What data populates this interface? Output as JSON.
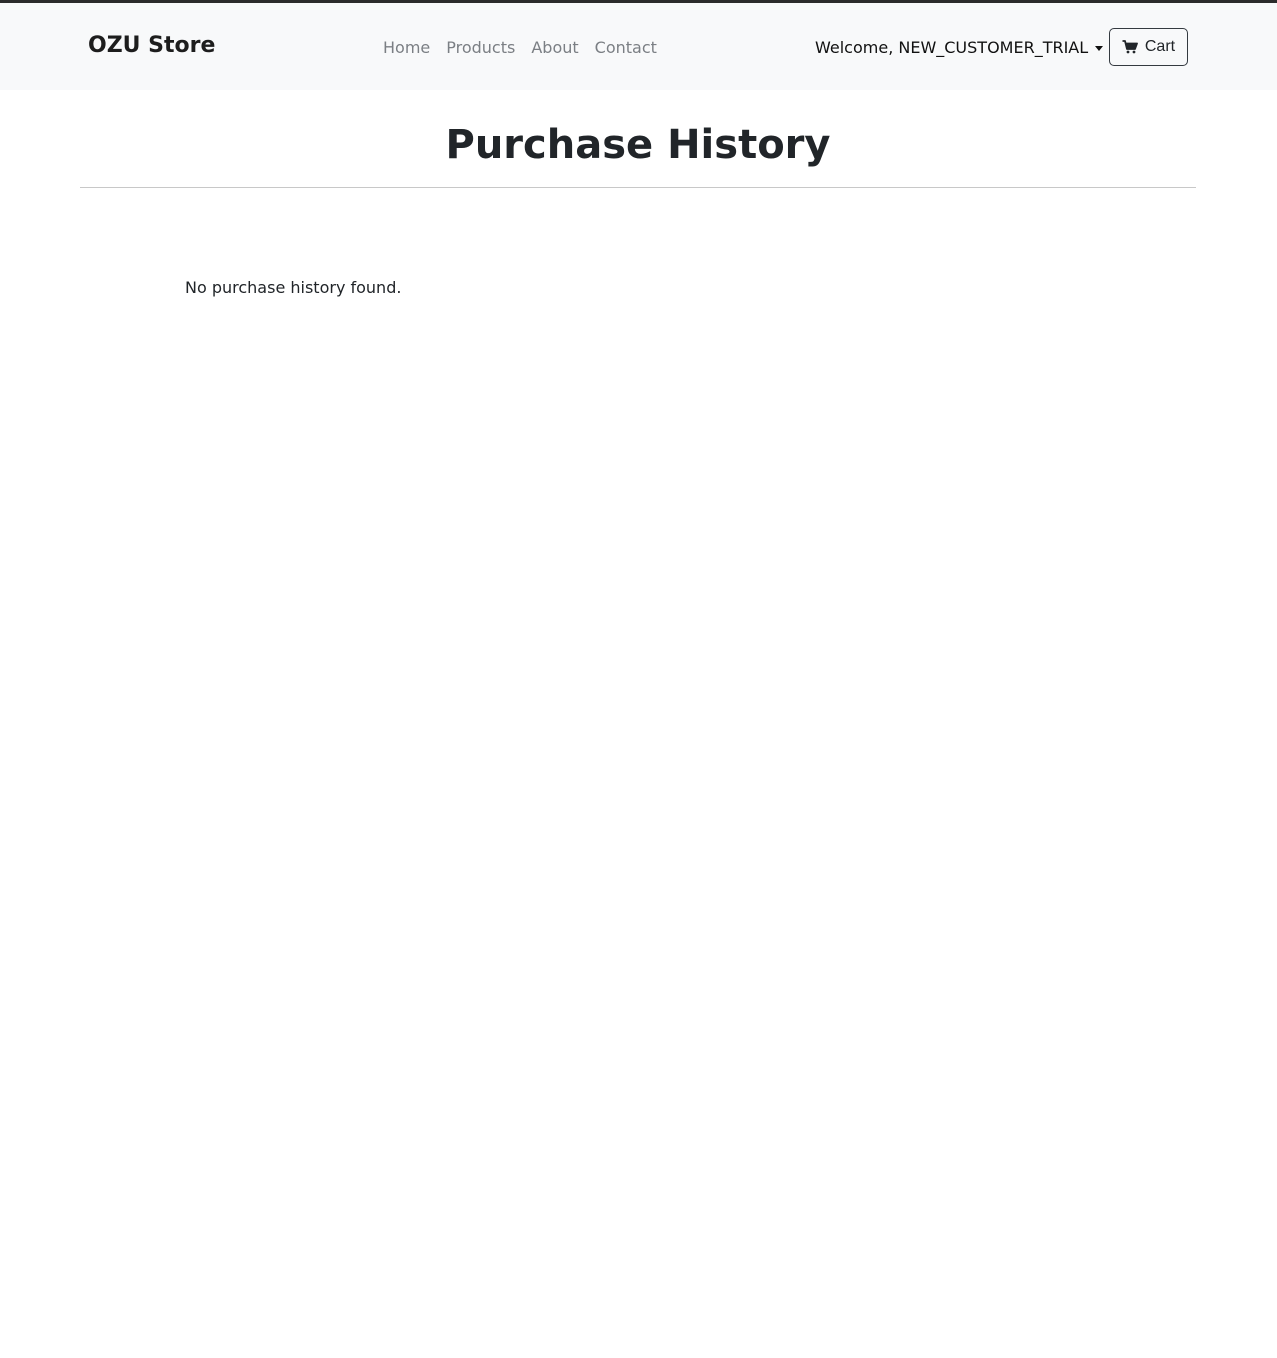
{
  "navbar": {
    "brand": "OZU Store",
    "links": [
      {
        "label": "Home"
      },
      {
        "label": "Products"
      },
      {
        "label": "About"
      },
      {
        "label": "Contact"
      }
    ],
    "user_menu_label": "Welcome, NEW_CUSTOMER_TRIAL",
    "cart_label": "Cart",
    "cart_icon": "shopping-cart-icon"
  },
  "main": {
    "title": "Purchase History",
    "empty_message": "No purchase history found."
  },
  "colors": {
    "navbar_bg": "#f8f9fa",
    "nav_link": "#7b7f84",
    "text": "#212529",
    "divider": "#c8c8c8"
  }
}
